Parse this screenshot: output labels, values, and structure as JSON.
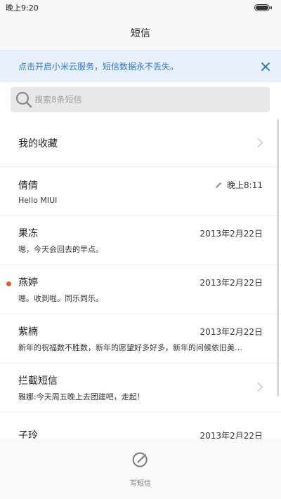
{
  "status_bar": {
    "time": "晚上9:20"
  },
  "header": {
    "title": "短信"
  },
  "banner": {
    "text": "点击开启小米云服务，短信数据永不丢失。"
  },
  "search": {
    "placeholder": "搜索8条短信"
  },
  "favorites": {
    "label": "我的收藏"
  },
  "conversations": [
    {
      "name": "倩倩",
      "time": "晚上8:11",
      "preview": "Hello MIUI",
      "draft": true
    },
    {
      "name": "果冻",
      "time": "2013年2月22日",
      "preview": "嗯，今天会回去的早点。"
    },
    {
      "name": "燕婷",
      "time": "2013年2月22日",
      "preview": "嗯。收到啦。同乐同乐。",
      "unread": true
    },
    {
      "name": "紫楠",
      "time": "2013年2月22日",
      "preview": "新年的祝福数不胜数，新年的愿望好多好多，新年的问候依旧美…"
    },
    {
      "name": "拦截短信",
      "preview": "雅娜:今天周五晚上去团建吧，走起！"
    },
    {
      "name": "子玲",
      "time": "2013年2月22日",
      "preview": ""
    }
  ],
  "bottom_bar": {
    "compose_label": "写短信"
  },
  "colors": {
    "accent": "#2b78c9",
    "unread": "#f05a24",
    "banner_bg": "#e8f1fb"
  }
}
